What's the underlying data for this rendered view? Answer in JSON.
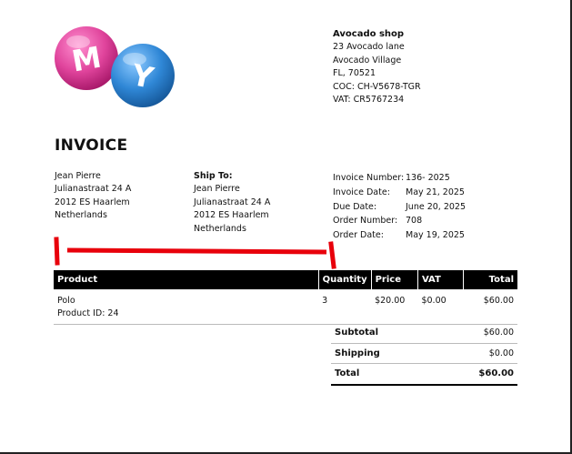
{
  "logo": {
    "letter1": "M",
    "letter2": "Y"
  },
  "shop": {
    "name": "Avocado shop",
    "lines": [
      "23 Avocado lane",
      "Avocado Village",
      "FL, 70521",
      "COC: CH-V5678-TGR",
      "VAT: CR5767234"
    ]
  },
  "invoice_title": "INVOICE",
  "bill_to": {
    "lines": [
      "Jean Pierre",
      "Julianastraat 24 A",
      "2012 ES Haarlem",
      "Netherlands"
    ]
  },
  "ship_to": {
    "label": "Ship To:",
    "lines": [
      "Jean Pierre",
      "Julianastraat 24 A",
      "2012 ES Haarlem",
      "Netherlands"
    ]
  },
  "meta": [
    {
      "key": "Invoice Number:",
      "value": "136- 2025"
    },
    {
      "key": "Invoice Date:",
      "value": "May 21, 2025"
    },
    {
      "key": "Due Date:",
      "value": "June 20, 2025"
    },
    {
      "key": "Order Number:",
      "value": "708"
    },
    {
      "key": "Order Date:",
      "value": "May 19, 2025"
    }
  ],
  "table": {
    "headers": [
      "Product",
      "Quantity",
      "Price",
      "VAT",
      "Total"
    ],
    "rows": [
      {
        "product": "Polo",
        "product_id": "Product ID: 24",
        "quantity": "3",
        "price": "$20.00",
        "vat": "$0.00",
        "total": "$60.00"
      }
    ]
  },
  "totals": [
    {
      "label": "Subtotal",
      "value": "$60.00"
    },
    {
      "label": "Shipping",
      "value": "$0.00"
    },
    {
      "label": "Total",
      "value": "$60.00"
    }
  ],
  "colors": {
    "ball_pink": "#e0449c",
    "ball_blue": "#2f87d6",
    "bracket_red": "#e8000b",
    "header_black": "#000000"
  }
}
